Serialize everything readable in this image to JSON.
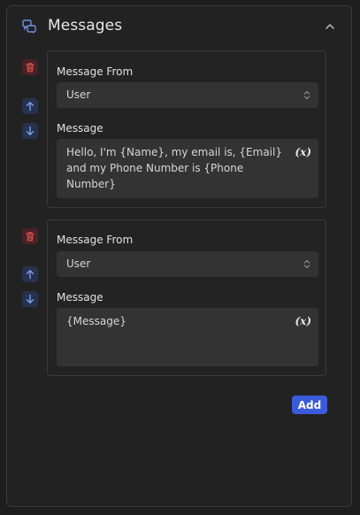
{
  "header": {
    "title": "Messages"
  },
  "messages": [
    {
      "from_label": "Message From",
      "from_value": "User",
      "message_label": "Message",
      "message_text": "Hello, I'm {Name}, my email is, {Email} and my Phone Number is {Phone Number}",
      "variable_icon": "(x)"
    },
    {
      "from_label": "Message From",
      "from_value": "User",
      "message_label": "Message",
      "message_text": "{Message}",
      "variable_icon": "(x)"
    }
  ],
  "add_label": "Add",
  "colors": {
    "accent": "#3b5bdb",
    "delete": "#d9534f",
    "move": "#7d9df0",
    "header_icon": "#6f8fe8"
  }
}
